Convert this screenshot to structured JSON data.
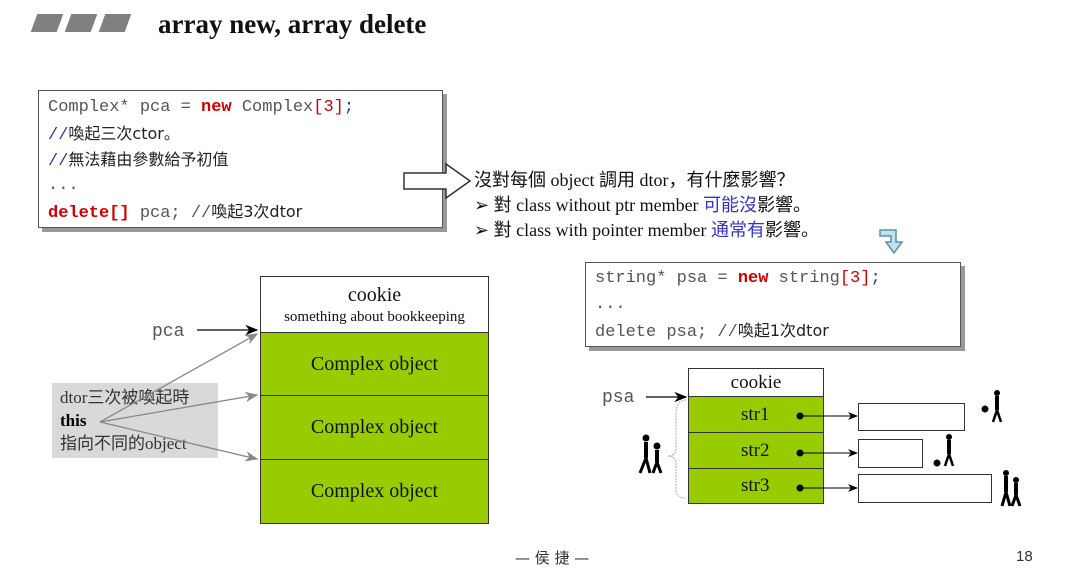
{
  "title": "array new, array delete",
  "code1": {
    "l1": {
      "a": "Complex* pca = ",
      "b": "new",
      "c": " Complex",
      "d": "[3]",
      "e": ";"
    },
    "l2": {
      "a": "//",
      "b": "喚起三次ctor。"
    },
    "l3": {
      "a": "//",
      "b": "無法藉由參數給予初值"
    },
    "l4": "...",
    "l5": {
      "a": "delete[]",
      "b": " pca; //",
      "c": "喚起3次dtor"
    }
  },
  "notes": {
    "q": "沒對每個 object 調用 dtor，有什麼影響？",
    "b1": {
      "a": "對 class without ptr member ",
      "b": "可能沒",
      "c": "影響。"
    },
    "b2": {
      "a": "對 class with pointer member ",
      "b": "通常有",
      "c": "影響。"
    }
  },
  "code2": {
    "l1": {
      "a": "string* psa = ",
      "b": "new",
      "c": " string",
      "d": "[3]",
      "e": ";"
    },
    "l2": "...",
    "l3": {
      "a": "delete psa; //",
      "b": "喚起1次dtor"
    }
  },
  "left_diagram": {
    "pointer": "pca",
    "cookie": "cookie",
    "cookie_sub": "something about bookkeeping",
    "objects": [
      "Complex object",
      "Complex object",
      "Complex object"
    ],
    "note": {
      "l1": "dtor三次被喚起時",
      "l2": "this",
      "l3": "指向不同的object"
    }
  },
  "right_diagram": {
    "pointer": "psa",
    "cookie": "cookie",
    "strings": [
      "str1",
      "str2",
      "str3"
    ]
  },
  "colors": {
    "green": "#99cc00",
    "keyword": "#d00000",
    "blue": "#3333cc"
  },
  "footer": {
    "author": "— 侯 捷 —",
    "page": "18"
  }
}
